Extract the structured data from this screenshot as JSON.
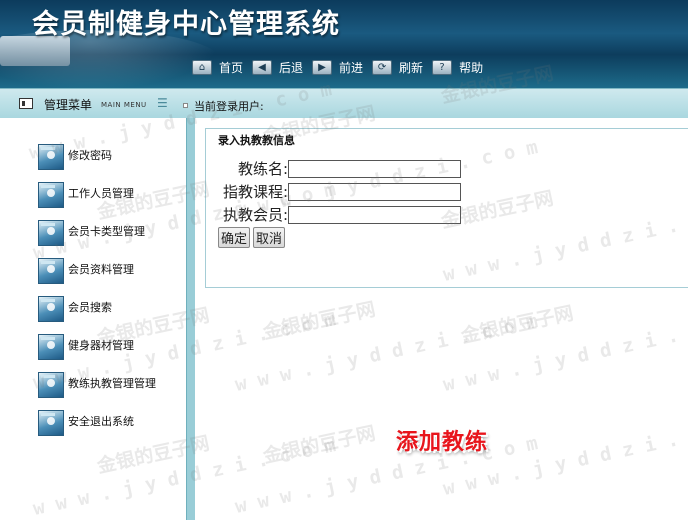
{
  "app": {
    "title": "会员制健身中心管理系统"
  },
  "nav": {
    "items": [
      {
        "label": "首页",
        "icon": "home-icon"
      },
      {
        "label": "后退",
        "icon": "back-arrow-icon"
      },
      {
        "label": "前进",
        "icon": "forward-arrow-icon"
      },
      {
        "label": "刷新",
        "icon": "refresh-icon"
      },
      {
        "label": "帮助",
        "icon": "help-icon"
      }
    ]
  },
  "bar": {
    "menu_title": "管理菜单",
    "menu_sub": "MAIN MENU",
    "current_user_label": "当前登录用户:"
  },
  "sidebar": {
    "items": [
      {
        "label": "修改密码"
      },
      {
        "label": "工作人员管理"
      },
      {
        "label": "会员卡类型管理"
      },
      {
        "label": "会员资料管理"
      },
      {
        "label": "会员搜索"
      },
      {
        "label": "健身器材管理"
      },
      {
        "label": "教练执教管理管理"
      },
      {
        "label": "安全退出系统"
      }
    ]
  },
  "form": {
    "title": "录入执教教信息",
    "fields": [
      {
        "label": "教练名:",
        "value": ""
      },
      {
        "label": "指教课程:",
        "value": ""
      },
      {
        "label": "执教会员:",
        "value": ""
      }
    ],
    "confirm_label": "确定",
    "cancel_label": "取消"
  },
  "promo": {
    "text": "添加教练"
  },
  "watermark": {
    "cn": "金银的豆子网",
    "url": "w w w . j y d d z i . c o m"
  },
  "colors": {
    "header": "#0d3d5d",
    "bar": "#a9d7df",
    "sidebar_edge": "#99cdd7",
    "promo": "#e8151c"
  }
}
